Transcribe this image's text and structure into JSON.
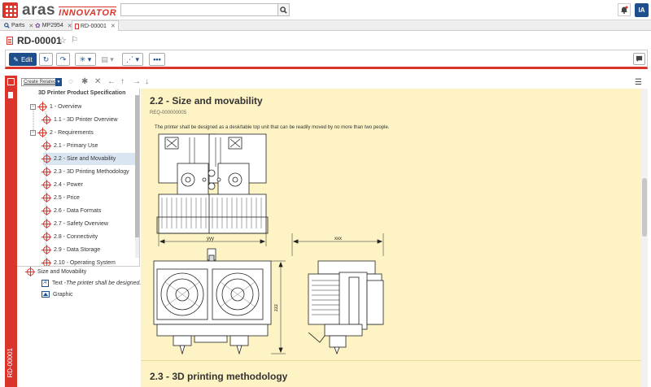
{
  "app": {
    "logo_main": "aras",
    "logo_sub": "INNOVATOR",
    "user_initials": "IA"
  },
  "icons": {
    "apps": "apps-grid-icon",
    "search": "search-icon",
    "bell": "bell-icon",
    "star": "star-icon",
    "flag": "flag-icon"
  },
  "colors": {
    "brand_red": "#d9352c",
    "accent_blue": "#1f4e8c",
    "doc_bg": "#fdf3c4",
    "selected": "#d9e6f2"
  },
  "tabs": [
    {
      "label": "Parts",
      "icon": "search-icon"
    },
    {
      "label": "MP2954",
      "icon": "gear-icon"
    },
    {
      "label": "RD-00001",
      "icon": "document-icon"
    }
  ],
  "item": {
    "title": "RD-00001",
    "vertical_label": "RD-00001"
  },
  "toolbar": {
    "edit_label": "Edit"
  },
  "subtoolbar": {
    "create_related": "Create Related"
  },
  "tree": {
    "header": "3D Printer Product Specification",
    "items": [
      {
        "label": "1 - Overview",
        "level": 1,
        "expander": "−"
      },
      {
        "label": "1.1 - 3D Printer Overview",
        "level": 2
      },
      {
        "label": "2 - Requirements",
        "level": 1,
        "expander": "−"
      },
      {
        "label": "2.1 - Primary Use",
        "level": 2
      },
      {
        "label": "2.2 - Size and Movability",
        "level": 2,
        "selected": true
      },
      {
        "label": "2.3 - 3D Printing Methodology",
        "level": 2
      },
      {
        "label": "2.4 - Power",
        "level": 2
      },
      {
        "label": "2.5 - Price",
        "level": 2
      },
      {
        "label": "2.6 - Data Formats",
        "level": 2
      },
      {
        "label": "2.7 - Safety Overview",
        "level": 2
      },
      {
        "label": "2.8 - Connectivity",
        "level": 2
      },
      {
        "label": "2.9 - Data Storage",
        "level": 2
      },
      {
        "label": "2.10 - Operating System",
        "level": 2
      }
    ]
  },
  "props": {
    "title": "Size and Movability",
    "text_label": "Text - ",
    "text_value": "The printer shall be designed...",
    "graphic_label": "Graphic"
  },
  "doc": {
    "section_title": "2.2 - Size and movability",
    "req_id": "REQ-000000005",
    "body": "The printer shall be designed as a desk/table top unit that can be readily moved by no more than two people.",
    "dim_yyy": "yyy",
    "dim_xxx": "xxx",
    "dim_zzz": "zzz",
    "next_section": "2.3 - 3D printing methodology"
  }
}
